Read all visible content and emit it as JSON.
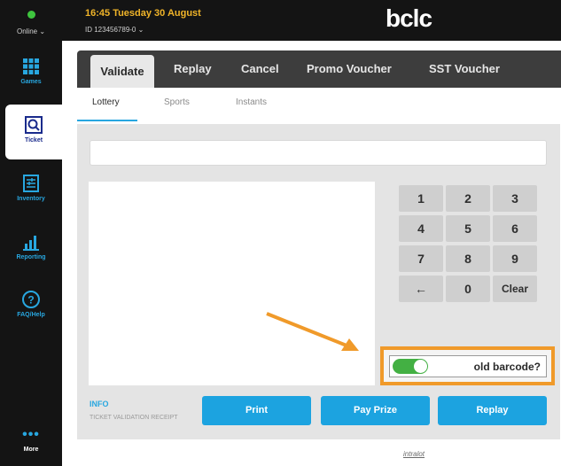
{
  "sidebar": {
    "status": "Online ⌄",
    "items": [
      {
        "label": "Games",
        "icon": "grid-icon"
      },
      {
        "label": "Ticket",
        "icon": "ticket-search-icon"
      },
      {
        "label": "Inventory",
        "icon": "inventory-icon"
      },
      {
        "label": "Reporting",
        "icon": "bar-chart-icon"
      },
      {
        "label": "FAQ/Help",
        "icon": "help-icon"
      },
      {
        "label": "More",
        "icon": "more-dots-icon"
      }
    ],
    "more_dots": "•••"
  },
  "header": {
    "datetime": "16:45 Tuesday 30 August",
    "terminal_id": "ID 123456789-0 ⌄",
    "logo": "bclc"
  },
  "tabs": [
    "Validate",
    "Replay",
    "Cancel",
    "Promo Voucher",
    "SST Voucher"
  ],
  "subtabs": [
    "Lottery",
    "Sports",
    "Instants"
  ],
  "keypad": [
    "1",
    "2",
    "3",
    "4",
    "5",
    "6",
    "7",
    "8",
    "9",
    "←",
    "0",
    "Clear"
  ],
  "toggle": {
    "label": "old barcode?",
    "on": true
  },
  "info": {
    "title": "INFO",
    "subtitle": "TICKET VALIDATION RECEIPT"
  },
  "actions": {
    "print": "Print",
    "pay_prize": "Pay Prize",
    "replay": "Replay"
  },
  "footer": {
    "brand": "intralot"
  },
  "colors": {
    "accent": "#1ca3e0",
    "highlight": "#f09a2a",
    "toggle_on": "#43b043",
    "datetime": "#f0b429"
  }
}
